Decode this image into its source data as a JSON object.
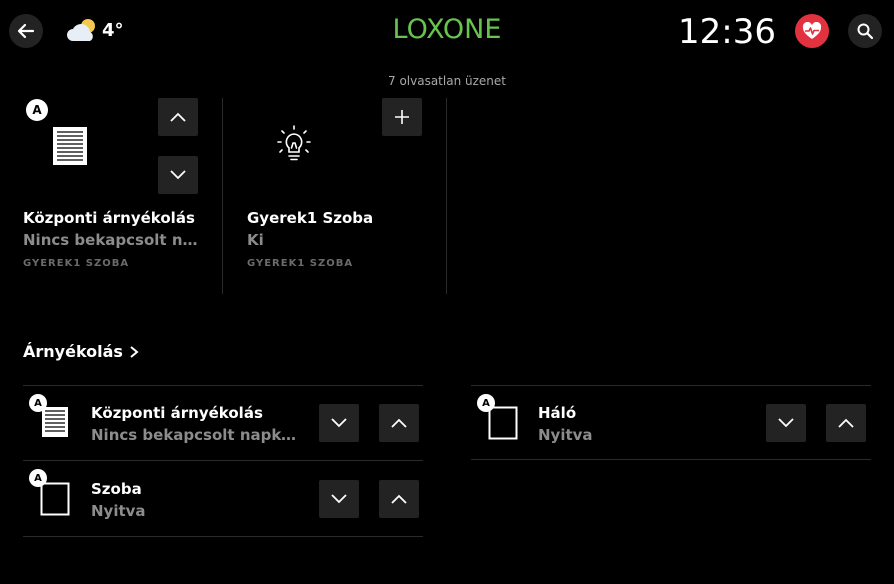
{
  "header": {
    "back_icon": "arrow-left-icon",
    "weather_icon": "partly-cloudy-icon",
    "temperature": "4°",
    "logo": "LOXONE",
    "time": "12:36",
    "health_icon": "heart-pulse-icon",
    "search_icon": "search-icon",
    "messages": "7 olvasatlan üzenet",
    "colors": {
      "logo": "#69c350",
      "health": "#e2323f"
    }
  },
  "tiles": [
    {
      "badge": "A",
      "icon": "blinds-icon",
      "title": "Központi árnyékolás",
      "subtitle": "Nincs bekapcsolt napkö...",
      "room": "GYEREK1 SZOBA",
      "up_icon": "chevron-up-icon",
      "down_icon": "chevron-down-icon"
    },
    {
      "icon": "lightbulb-icon",
      "title": "Gyerek1 Szoba",
      "subtitle": "Ki",
      "room": "GYEREK1 SZOBA",
      "add_icon": "plus-icon"
    }
  ],
  "section": {
    "title": "Árnyékolás",
    "arrow_icon": "chevron-right-icon",
    "items": [
      {
        "badge": "A",
        "icon": "blinds-icon",
        "title": "Központi árnyékolás",
        "subtitle": "Nincs bekapcsolt napkörnyezet"
      },
      {
        "badge": "A",
        "icon": "window-icon",
        "title": "Háló",
        "subtitle": "Nyitva"
      },
      {
        "badge": "A",
        "icon": "window-icon",
        "title": "Szoba",
        "subtitle": "Nyitva"
      }
    ]
  }
}
